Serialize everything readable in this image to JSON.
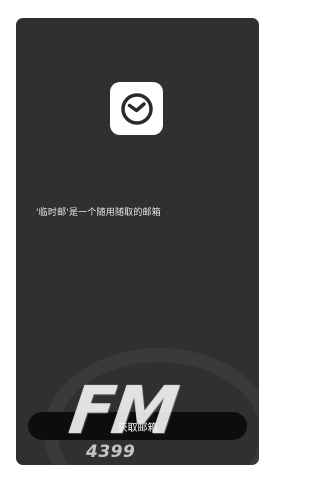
{
  "app": {
    "icon": "clock-icon",
    "tagline": "'临时邮'是一个随用随取的邮箱"
  },
  "actions": {
    "get_mailbox_label": "获取邮箱"
  },
  "watermark": {
    "logo_text": "FM",
    "number_text": "4399"
  },
  "colors": {
    "screen_background": "#303033",
    "button_background": "#0d0d0d",
    "icon_background": "#ffffff",
    "text": "#e8e8e8"
  }
}
